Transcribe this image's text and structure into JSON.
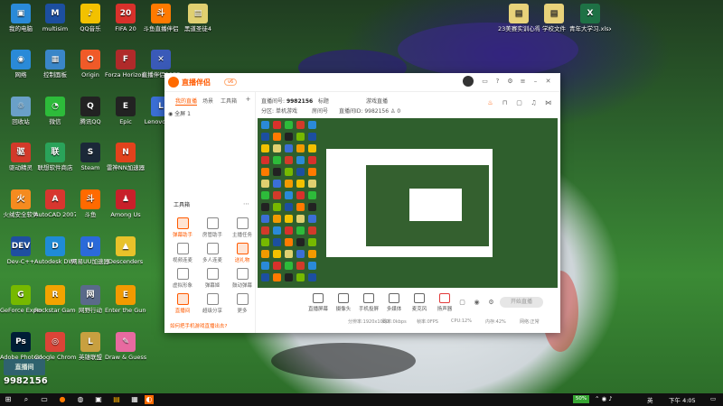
{
  "desktop_icons": [
    {
      "label": "我的电脑",
      "color": "#2a8ad8",
      "glyph": "▣"
    },
    {
      "label": "multisim",
      "color": "#1c4fa0",
      "glyph": "M"
    },
    {
      "label": "QQ音乐",
      "color": "#f2c100",
      "glyph": "♪"
    },
    {
      "label": "FIFA 20",
      "color": "#d8312b",
      "glyph": "20"
    },
    {
      "label": "斗鱼直播伴侣",
      "color": "#ff7a00",
      "glyph": "斗"
    },
    {
      "label": "黑道圣徒4",
      "color": "#e0d070",
      "glyph": "▤"
    },
    {
      "label": "网络",
      "color": "#2a8ad8",
      "glyph": "◉"
    },
    {
      "label": "控制面板",
      "color": "#3a86c8",
      "glyph": "▦"
    },
    {
      "label": "Origin",
      "color": "#f05a28",
      "glyph": "O"
    },
    {
      "label": "Forza Horizon 4",
      "color": "#b02a2a",
      "glyph": "F"
    },
    {
      "label": "直播伴侣2077",
      "color": "#3a5ab8",
      "glyph": "✕"
    },
    {
      "label": "回收站",
      "color": "#6aa0c8",
      "glyph": "♲"
    },
    {
      "label": "微信",
      "color": "#2dbb3a",
      "glyph": "◔"
    },
    {
      "label": "腾讯QQ",
      "color": "#222222",
      "glyph": "Q"
    },
    {
      "label": "Epic",
      "color": "#222222",
      "glyph": "E"
    },
    {
      "label": "Lenovo驱动",
      "color": "#3b6fd6",
      "glyph": "L"
    },
    {
      "label": "驱动精灵",
      "color": "#d23a2a",
      "glyph": "驱"
    },
    {
      "label": "联想软件商店",
      "color": "#2aa35a",
      "glyph": "联"
    },
    {
      "label": "Steam",
      "color": "#1b2838",
      "glyph": "S"
    },
    {
      "label": "雷神NN加速器",
      "color": "#e2421c",
      "glyph": "N"
    },
    {
      "label": "火绒安全软件",
      "color": "#f58b1f",
      "glyph": "火"
    },
    {
      "label": "AutoCAD 2007",
      "color": "#d7362f",
      "glyph": "A"
    },
    {
      "label": "斗鱼",
      "color": "#ff6a00",
      "glyph": "斗"
    },
    {
      "label": "Among Us",
      "color": "#c8202a",
      "glyph": "♟"
    },
    {
      "label": "Dev-C++",
      "color": "#1f4fa0",
      "glyph": "DEV"
    },
    {
      "label": "Autodesk DWF View",
      "color": "#1f8bd6",
      "glyph": "D"
    },
    {
      "label": "网易UU加速器",
      "color": "#2b6ad9",
      "glyph": "U"
    },
    {
      "label": "Descenders",
      "color": "#e8c22a",
      "glyph": "▲"
    },
    {
      "label": "GeForce Experience",
      "color": "#76b900",
      "glyph": "G"
    },
    {
      "label": "Rockstar Games",
      "color": "#f2a300",
      "glyph": "R"
    },
    {
      "label": "网野行动",
      "color": "#5a6a8a",
      "glyph": "网"
    },
    {
      "label": "Enter the Gungeon",
      "color": "#f29a00",
      "glyph": "E"
    },
    {
      "label": "Adobe Photoshop",
      "color": "#001e36",
      "glyph": "Ps"
    },
    {
      "label": "Google Chrome",
      "color": "#db4437",
      "glyph": "◎"
    },
    {
      "label": "英雄联盟",
      "color": "#c8a040",
      "glyph": "L"
    },
    {
      "label": "Draw & Guess",
      "color": "#e86aa0",
      "glyph": "✎"
    }
  ],
  "right_icons": [
    {
      "label": "23美赛实训心得",
      "color": "#e8d27a",
      "glyph": "▤"
    },
    {
      "label": "学校文件",
      "color": "#e8d27a",
      "glyph": "▤"
    },
    {
      "label": "青年大学习.xlsx",
      "color": "#1e7145",
      "glyph": "X"
    }
  ],
  "app": {
    "name": "直播伴侣",
    "version": "v6",
    "tabs": [
      "我的直播",
      "场景",
      "工具箱"
    ],
    "scene_label": "全屏 1",
    "add_icon": "+",
    "tools_title": "工具箱",
    "tools": [
      {
        "label": "弹幕助手",
        "hot": true
      },
      {
        "label": "房管助手",
        "hot": false
      },
      {
        "label": "主播任务",
        "hot": false
      },
      {
        "label": "视频连麦",
        "hot": false
      },
      {
        "label": "多人连麦",
        "hot": false
      },
      {
        "label": "送礼物",
        "hot": true
      },
      {
        "label": "虚拟形象",
        "hot": false
      },
      {
        "label": "弹幕姬",
        "hot": false
      },
      {
        "label": "鼓动弹幕",
        "hot": false
      },
      {
        "label": "直播间",
        "hot": true
      },
      {
        "label": "超级分享",
        "hot": false
      },
      {
        "label": "更多",
        "hot": false
      }
    ],
    "promo": "如何把手机游戏直播出去?",
    "room": {
      "name_label": "直播间号:",
      "room_id": "9982156",
      "title_label": "标题",
      "tag": "游戏直播",
      "category_label": "分区:",
      "category": "单机游戏",
      "room_label": "房间号",
      "id_label": "直播间ID:",
      "id_value": "9982156",
      "count": "0"
    },
    "bottom_items": [
      "直播屏幕",
      "摄像头",
      "手机投屏",
      "多媒体",
      "麦克风",
      "扬声器"
    ],
    "start_label": "开始直播",
    "stats": [
      "分辨率:1920x1080",
      "码率:0kbps",
      "帧率:0FPS",
      "CPU:12%",
      "内存:42%",
      "网络:正常"
    ]
  },
  "taskbar": {
    "time": "下午 4:05",
    "battery": "50%",
    "lang": "英"
  },
  "watermark": {
    "logo": "直播间",
    "room_id": "9982156"
  }
}
